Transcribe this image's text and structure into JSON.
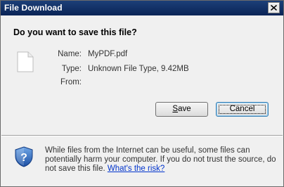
{
  "window": {
    "title": "File Download"
  },
  "dialog": {
    "question": "Do you want to save this file?",
    "file_icon": "document-icon",
    "fields": {
      "name_label": "Name:",
      "name_value": "MyPDF.pdf",
      "type_label": "Type:",
      "type_value": "Unknown File Type, 9.42MB",
      "from_label": "From:",
      "from_value": ""
    },
    "buttons": {
      "save_prefix": "",
      "save_key": "S",
      "save_rest": "ave",
      "cancel_label": "Cancel"
    }
  },
  "footer": {
    "icon": "shield-icon",
    "warning": "While files from the Internet can be useful, some files can potentially harm your computer. If you do not trust the source, do not save this file.",
    "link": "What's the risk?"
  },
  "colors": {
    "titlebar": "#0a2456",
    "link": "#0033cc"
  }
}
